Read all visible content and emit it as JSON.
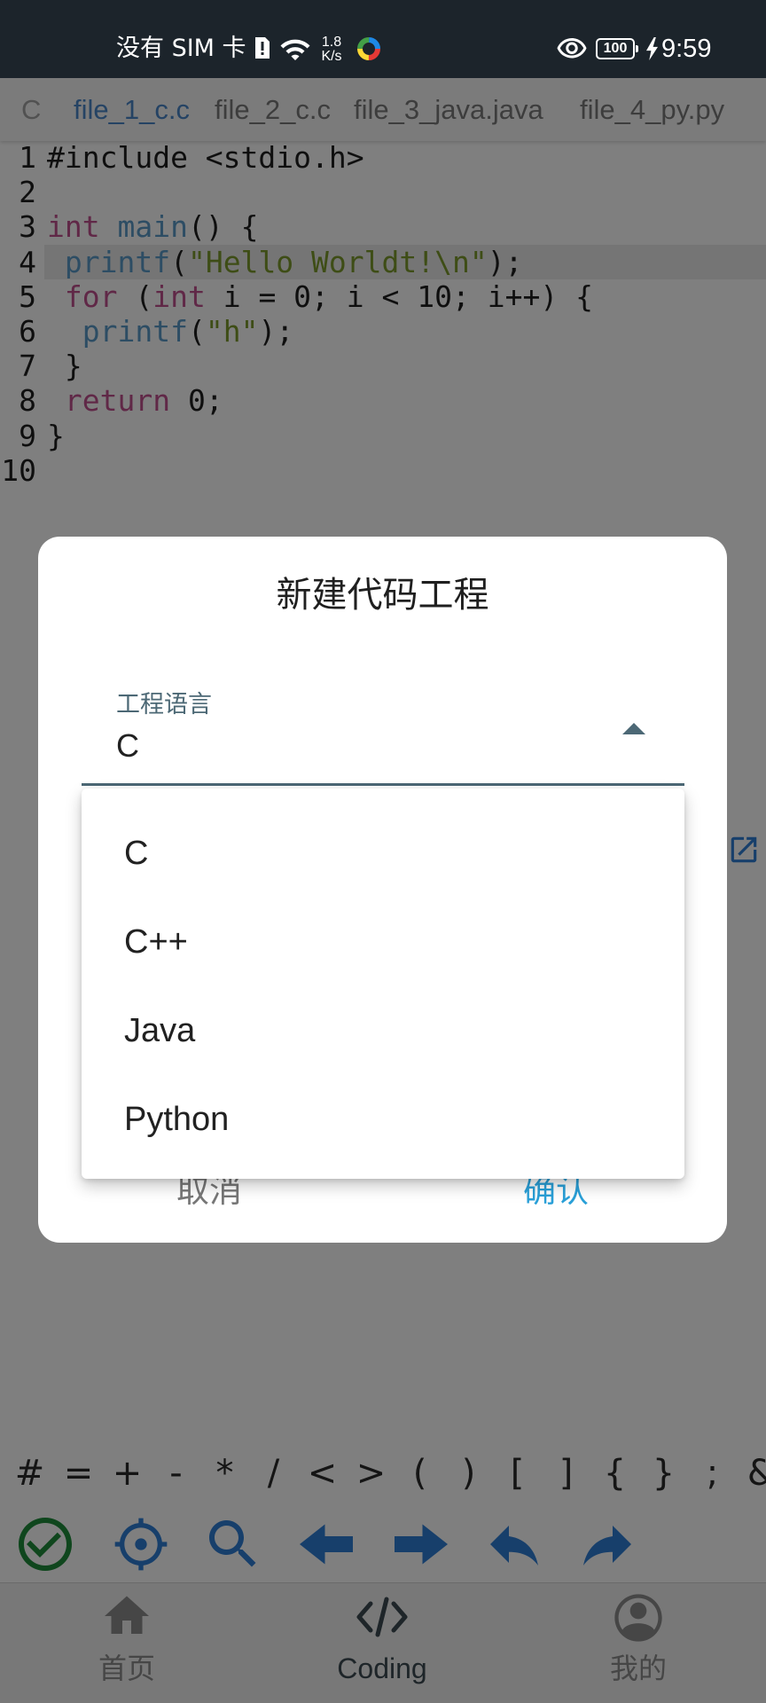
{
  "status_bar": {
    "carrier": "没有 SIM 卡",
    "net_speed_value": "1.8",
    "net_speed_unit": "K/s",
    "battery_level": "100",
    "time": "9:59",
    "icons": [
      "sim-alert-icon",
      "wifi-icon",
      "app-ring-icon",
      "eye-icon",
      "battery-icon",
      "charging-bolt-icon"
    ]
  },
  "tab_bar": {
    "project_label": "C",
    "tabs": [
      {
        "label": "file_1_c.c",
        "active": true
      },
      {
        "label": "file_2_c.c",
        "active": false
      },
      {
        "label": "file_3_java.java",
        "active": false
      },
      {
        "label": "file_4_py.py",
        "active": false
      }
    ]
  },
  "editor": {
    "current_line": 4,
    "lines": [
      {
        "number": "1",
        "tokens": [
          {
            "type": "plain",
            "text": "#include <stdio.h>"
          }
        ]
      },
      {
        "number": "2",
        "tokens": []
      },
      {
        "number": "3",
        "tokens": [
          {
            "type": "keyword",
            "text": "int"
          },
          {
            "type": "plain",
            "text": " "
          },
          {
            "type": "function",
            "text": "main"
          },
          {
            "type": "plain",
            "text": "() {"
          }
        ]
      },
      {
        "number": "4",
        "tokens": [
          {
            "type": "plain",
            "text": " "
          },
          {
            "type": "function",
            "text": "printf"
          },
          {
            "type": "plain",
            "text": "("
          },
          {
            "type": "string",
            "text": "\"Hello Worldt!\\n\""
          },
          {
            "type": "plain",
            "text": ");"
          }
        ]
      },
      {
        "number": "5",
        "tokens": [
          {
            "type": "plain",
            "text": " "
          },
          {
            "type": "keyword",
            "text": "for"
          },
          {
            "type": "plain",
            "text": " ("
          },
          {
            "type": "keyword",
            "text": "int"
          },
          {
            "type": "plain",
            "text": " i = 0; i < 10; i++) {"
          }
        ]
      },
      {
        "number": "6",
        "tokens": [
          {
            "type": "plain",
            "text": "  "
          },
          {
            "type": "function",
            "text": "printf"
          },
          {
            "type": "plain",
            "text": "("
          },
          {
            "type": "string",
            "text": "\"h\""
          },
          {
            "type": "plain",
            "text": ");"
          }
        ]
      },
      {
        "number": "7",
        "tokens": [
          {
            "type": "plain",
            "text": " }"
          }
        ]
      },
      {
        "number": "8",
        "tokens": [
          {
            "type": "plain",
            "text": " "
          },
          {
            "type": "keyword",
            "text": "return"
          },
          {
            "type": "plain",
            "text": " 0;"
          }
        ]
      },
      {
        "number": "9",
        "tokens": [
          {
            "type": "plain",
            "text": "}"
          }
        ]
      },
      {
        "number": "10",
        "tokens": []
      }
    ]
  },
  "side_icon": "open-in-new-icon",
  "symbols": [
    "#",
    "=",
    "+",
    "-",
    "*",
    "/",
    "<",
    ">",
    "(",
    ")",
    "[",
    "]",
    "{",
    "}",
    ";",
    "&"
  ],
  "toolbar": {
    "icons": [
      "check-circle-icon",
      "gps-target-icon",
      "search-icon",
      "arrow-left-icon",
      "arrow-right-icon",
      "undo-icon",
      "redo-icon"
    ]
  },
  "dialog": {
    "title": "新建代码工程",
    "field_label": "工程语言",
    "selected_value": "C",
    "options": [
      "C",
      "C++",
      "Java",
      "Python"
    ],
    "cancel_label": "取消",
    "confirm_label": "确认"
  },
  "bottom_nav": {
    "items": [
      {
        "label": "首页",
        "icon": "home-icon",
        "active": false
      },
      {
        "label": "Coding",
        "icon": "code-icon",
        "active": true
      },
      {
        "label": "我的",
        "icon": "account-circle-icon",
        "active": false
      }
    ]
  },
  "colors": {
    "status_bar": "#1c242b",
    "accent": "#4a86c8",
    "confirm": "#2aa0d8",
    "field": "#4c6875",
    "keyword": "#c0508f",
    "function": "#5a9ac8",
    "string": "#7c9a2c",
    "success": "#1e8c3a",
    "toolbar_icon": "#2f7fd6",
    "nav_active": "#3c4a52",
    "nav_inactive": "#8c8c8c"
  }
}
